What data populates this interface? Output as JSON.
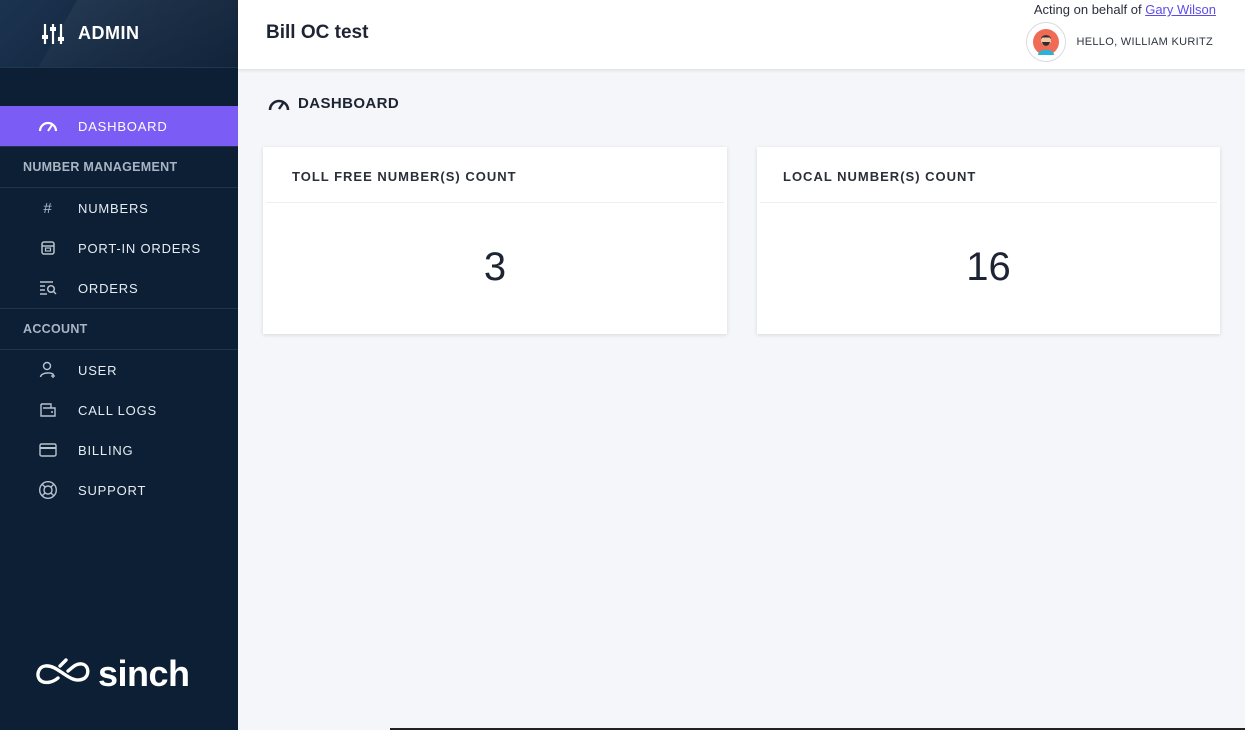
{
  "brand": {
    "title": "ADMIN"
  },
  "header": {
    "title": "Bill OC test",
    "acting_prefix": "Acting on behalf of",
    "acting_user": "Gary Wilson",
    "greeting": "HELLO, WILLIAM KURITZ"
  },
  "sidebar": {
    "dashboard": "DASHBOARD",
    "section_number_management": "NUMBER MANAGEMENT",
    "numbers": "NUMBERS",
    "port_in_orders": "PORT-IN ORDERS",
    "orders": "ORDERS",
    "section_account": "ACCOUNT",
    "user": "USER",
    "call_logs": "CALL LOGS",
    "billing": "BILLING",
    "support": "SUPPORT",
    "footer_logo": "sinch"
  },
  "main": {
    "section_title": "DASHBOARD",
    "cards": [
      {
        "title": "TOLL FREE NUMBER(S) COUNT",
        "value": "3"
      },
      {
        "title": "LOCAL NUMBER(S) COUNT",
        "value": "16"
      }
    ]
  },
  "colors": {
    "sidebar_bg": "#0c1f35",
    "active_item": "#7b5cf5",
    "link": "#5b4de8"
  }
}
